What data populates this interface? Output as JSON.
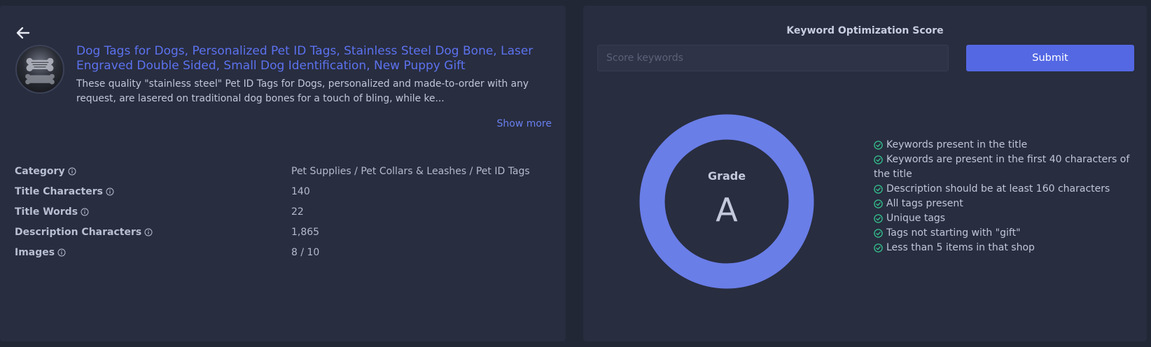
{
  "product": {
    "title": "Dog Tags for Dogs, Personalized Pet ID Tags, Stainless Steel Dog Bone, Laser Engraved Double Sided, Small Dog Identification, New Puppy Gift",
    "description": "These quality \"stainless steel\" Pet ID Tags for Dogs, personalized and made-to-order with any request, are lasered on traditional dog bones for a touch of bling, while ke...",
    "show_more": "Show more"
  },
  "stats": [
    {
      "label": "Category",
      "value": "Pet Supplies / Pet Collars & Leashes / Pet ID Tags"
    },
    {
      "label": "Title Characters",
      "value": "140"
    },
    {
      "label": "Title Words",
      "value": "22"
    },
    {
      "label": "Description Characters",
      "value": "1,865"
    },
    {
      "label": "Images",
      "value": "8 / 10"
    }
  ],
  "score": {
    "title": "Keyword Optimization Score",
    "input_placeholder": "Score keywords",
    "submit_label": "Submit",
    "grade_label": "Grade",
    "grade_value": "A",
    "ring_color": "#6a7ee8",
    "check_color": "#34c38f",
    "checks": [
      "Keywords present in the title",
      "Keywords are present in the first 40 characters of the title",
      "Description should be at least 160 characters",
      "All tags present",
      "Unique tags",
      "Tags not starting with \"gift\"",
      "Less than 5 items in that shop"
    ]
  },
  "icons": {
    "back": "arrow-left-icon",
    "info": "info-circle-icon",
    "check": "check-circle-icon"
  }
}
